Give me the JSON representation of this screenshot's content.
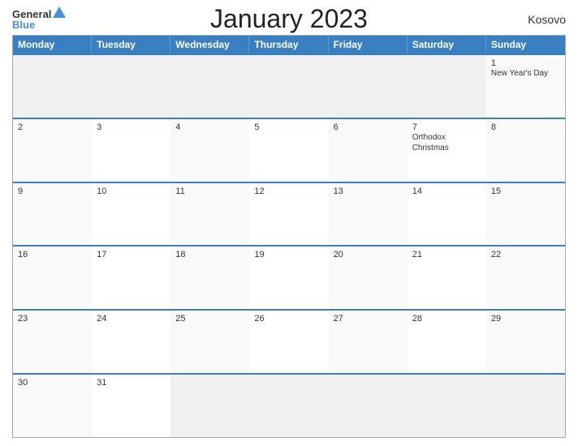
{
  "header": {
    "logo_general": "General",
    "logo_blue": "Blue",
    "title": "January 2023",
    "country": "Kosovo"
  },
  "calendar": {
    "days_of_week": [
      "Monday",
      "Tuesday",
      "Wednesday",
      "Thursday",
      "Friday",
      "Saturday",
      "Sunday"
    ],
    "weeks": [
      [
        {
          "day": "",
          "empty": true
        },
        {
          "day": "",
          "empty": true
        },
        {
          "day": "",
          "empty": true
        },
        {
          "day": "",
          "empty": true
        },
        {
          "day": "",
          "empty": true
        },
        {
          "day": "",
          "empty": true
        },
        {
          "day": "1",
          "event": "New Year's Day",
          "empty": false
        }
      ],
      [
        {
          "day": "2",
          "event": "",
          "empty": false
        },
        {
          "day": "3",
          "event": "",
          "empty": false
        },
        {
          "day": "4",
          "event": "",
          "empty": false
        },
        {
          "day": "5",
          "event": "",
          "empty": false
        },
        {
          "day": "6",
          "event": "",
          "empty": false
        },
        {
          "day": "7",
          "event": "Orthodox Christmas",
          "empty": false
        },
        {
          "day": "8",
          "event": "",
          "empty": false
        }
      ],
      [
        {
          "day": "9",
          "event": "",
          "empty": false
        },
        {
          "day": "10",
          "event": "",
          "empty": false
        },
        {
          "day": "11",
          "event": "",
          "empty": false
        },
        {
          "day": "12",
          "event": "",
          "empty": false
        },
        {
          "day": "13",
          "event": "",
          "empty": false
        },
        {
          "day": "14",
          "event": "",
          "empty": false
        },
        {
          "day": "15",
          "event": "",
          "empty": false
        }
      ],
      [
        {
          "day": "16",
          "event": "",
          "empty": false
        },
        {
          "day": "17",
          "event": "",
          "empty": false
        },
        {
          "day": "18",
          "event": "",
          "empty": false
        },
        {
          "day": "19",
          "event": "",
          "empty": false
        },
        {
          "day": "20",
          "event": "",
          "empty": false
        },
        {
          "day": "21",
          "event": "",
          "empty": false
        },
        {
          "day": "22",
          "event": "",
          "empty": false
        }
      ],
      [
        {
          "day": "23",
          "event": "",
          "empty": false
        },
        {
          "day": "24",
          "event": "",
          "empty": false
        },
        {
          "day": "25",
          "event": "",
          "empty": false
        },
        {
          "day": "26",
          "event": "",
          "empty": false
        },
        {
          "day": "27",
          "event": "",
          "empty": false
        },
        {
          "day": "28",
          "event": "",
          "empty": false
        },
        {
          "day": "29",
          "event": "",
          "empty": false
        }
      ],
      [
        {
          "day": "30",
          "event": "",
          "empty": false
        },
        {
          "day": "31",
          "event": "",
          "empty": false
        },
        {
          "day": "",
          "empty": true
        },
        {
          "day": "",
          "empty": true
        },
        {
          "day": "",
          "empty": true
        },
        {
          "day": "",
          "empty": true
        },
        {
          "day": "",
          "empty": true
        }
      ]
    ]
  }
}
